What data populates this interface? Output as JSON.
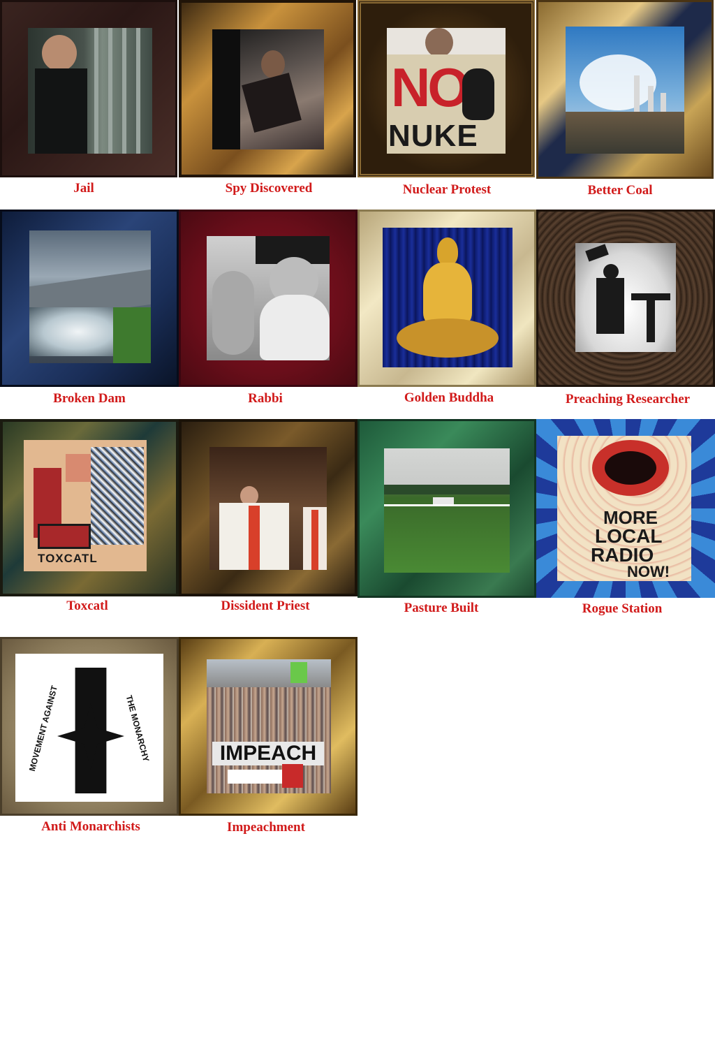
{
  "cards": [
    {
      "title": "Jail"
    },
    {
      "title": "Spy Discovered"
    },
    {
      "title": "Nuclear Protest",
      "sign_no": "NO",
      "sign_nuke": "NUKE"
    },
    {
      "title": "Better Coal"
    },
    {
      "title": "Broken Dam"
    },
    {
      "title": "Rabbi"
    },
    {
      "title": "Golden Buddha"
    },
    {
      "title": "Preaching Researcher"
    },
    {
      "title": "Toxcatl",
      "painting_text": "TOXCATL"
    },
    {
      "title": "Dissident Priest"
    },
    {
      "title": "Pasture Built"
    },
    {
      "title": "Rogue Station",
      "poster_lines": [
        "MORE",
        "LOCAL",
        "RADIO",
        "NOW!"
      ]
    },
    {
      "title": "Anti Monarchists",
      "logo_left": "MOVEMENT AGAINST",
      "logo_right": "THE MONARCHY"
    },
    {
      "title": "Impeachment",
      "banner": "IMPEACH"
    }
  ],
  "colors": {
    "label": "#d11a1a"
  }
}
